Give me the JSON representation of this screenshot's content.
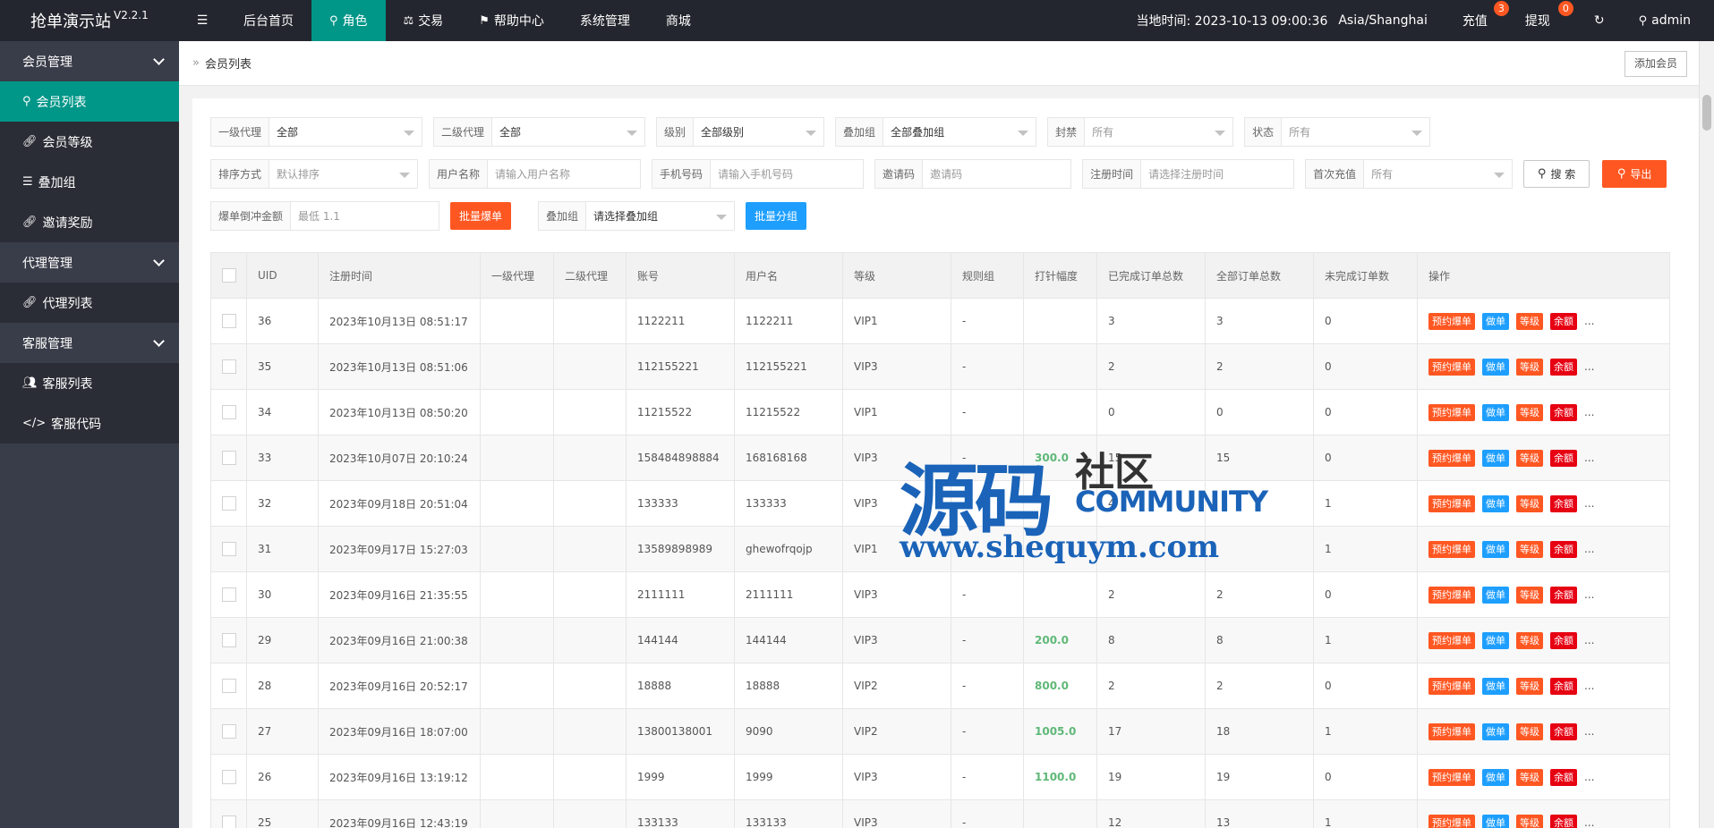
{
  "app": {
    "title": "抢单演示站",
    "version": "V2.2.1"
  },
  "topnav": {
    "items": [
      "后台首页",
      "角色",
      "交易",
      "帮助中心",
      "系统管理",
      "商城"
    ],
    "time_label": "当地时间: 2023-10-13 09:00:36",
    "timezone": "Asia/Shanghai",
    "recharge": "充值",
    "recharge_badge": "3",
    "withdraw": "提现",
    "withdraw_badge": "0",
    "user": "admin"
  },
  "sidebar": {
    "group1": "会员管理",
    "items1": [
      "会员列表",
      "会员等级",
      "叠加组",
      "邀请奖励"
    ],
    "group2": "代理管理",
    "items2": [
      "代理列表"
    ],
    "group3": "客服管理",
    "items3": [
      "客服列表",
      "客服代码"
    ]
  },
  "breadcrumb": {
    "current": "会员列表",
    "add_button": "添加会员"
  },
  "filters": {
    "agent1_label": "一级代理",
    "agent1_value": "全部",
    "agent2_label": "二级代理",
    "agent2_value": "全部",
    "level_label": "级别",
    "level_value": "全部级别",
    "stack_label": "叠加组",
    "stack_value": "全部叠加组",
    "ban_label": "封禁",
    "ban_value": "所有",
    "status_label": "状态",
    "status_value": "所有",
    "sort_label": "排序方式",
    "sort_value": "默认排序",
    "username_label": "用户名称",
    "username_ph": "请输入用户名称",
    "phone_label": "手机号码",
    "phone_ph": "请输入手机号码",
    "invite_label": "邀请码",
    "invite_ph": "邀请码",
    "regtime_label": "注册时间",
    "regtime_ph": "请选择注册时间",
    "firstcharge_label": "首次充值",
    "firstcharge_value": "所有",
    "search_btn": "搜 索",
    "export_btn": "导出",
    "burst_label": "爆单倒冲金额",
    "burst_ph": "最低 1.1",
    "batch_burst_btn": "批量爆单",
    "stack2_label": "叠加组",
    "stack2_value": "请选择叠加组",
    "batch_group_btn": "批量分组"
  },
  "table": {
    "headers": [
      "",
      "UID",
      "注册时间",
      "一级代理",
      "二级代理",
      "账号",
      "用户名",
      "等级",
      "规则组",
      "打针幅度",
      "已完成订单总数",
      "全部订单总数",
      "未完成订单数",
      "操作"
    ],
    "rows": [
      [
        "36",
        "2023年10月13日 08:51:17",
        "",
        "",
        "1122211",
        "1122211",
        "VIP1",
        "-",
        "",
        "3",
        "3",
        "0"
      ],
      [
        "35",
        "2023年10月13日 08:51:06",
        "",
        "",
        "112155221",
        "112155221",
        "VIP3",
        "-",
        "",
        "2",
        "2",
        "0"
      ],
      [
        "34",
        "2023年10月13日 08:50:20",
        "",
        "",
        "11215522",
        "11215522",
        "VIP1",
        "-",
        "",
        "0",
        "0",
        "0"
      ],
      [
        "33",
        "2023年10月07日 20:10:24",
        "",
        "",
        "158484898884",
        "168168168",
        "VIP3",
        "-",
        "300.0",
        "15",
        "15",
        "0"
      ],
      [
        "32",
        "2023年09月18日 20:51:04",
        "",
        "",
        "133333",
        "133333",
        "VIP3",
        "-",
        "",
        "4",
        "",
        "1"
      ],
      [
        "31",
        "2023年09月17日 15:27:03",
        "",
        "",
        "13589898989",
        "ghewofrqojp",
        "VIP1",
        "-",
        "",
        "",
        "",
        "1"
      ],
      [
        "30",
        "2023年09月16日 21:35:55",
        "",
        "",
        "2111111",
        "2111111",
        "VIP3",
        "-",
        "",
        "2",
        "2",
        "0"
      ],
      [
        "29",
        "2023年09月16日 21:00:38",
        "",
        "",
        "144144",
        "144144",
        "VIP3",
        "-",
        "200.0",
        "8",
        "8",
        "1"
      ],
      [
        "28",
        "2023年09月16日 20:52:17",
        "",
        "",
        "18888",
        "18888",
        "VIP2",
        "-",
        "800.0",
        "2",
        "2",
        "0"
      ],
      [
        "27",
        "2023年09月16日 18:07:00",
        "",
        "",
        "13800138001",
        "9090",
        "VIP2",
        "-",
        "1005.0",
        "17",
        "18",
        "1"
      ],
      [
        "26",
        "2023年09月16日 13:19:12",
        "",
        "",
        "1999",
        "1999",
        "VIP3",
        "-",
        "1100.0",
        "19",
        "19",
        "0"
      ],
      [
        "25",
        "2023年09月16日 12:43:19",
        "",
        "",
        "133133",
        "133133",
        "VIP3",
        "-",
        "",
        "12",
        "13",
        "1"
      ]
    ],
    "actions": [
      "预约爆单",
      "做单",
      "等级",
      "余额",
      "..."
    ]
  },
  "watermark": {
    "cn1": "源码",
    "cn2": "社区",
    "en": "COMMUNITY",
    "url": "www.shequym.com"
  }
}
